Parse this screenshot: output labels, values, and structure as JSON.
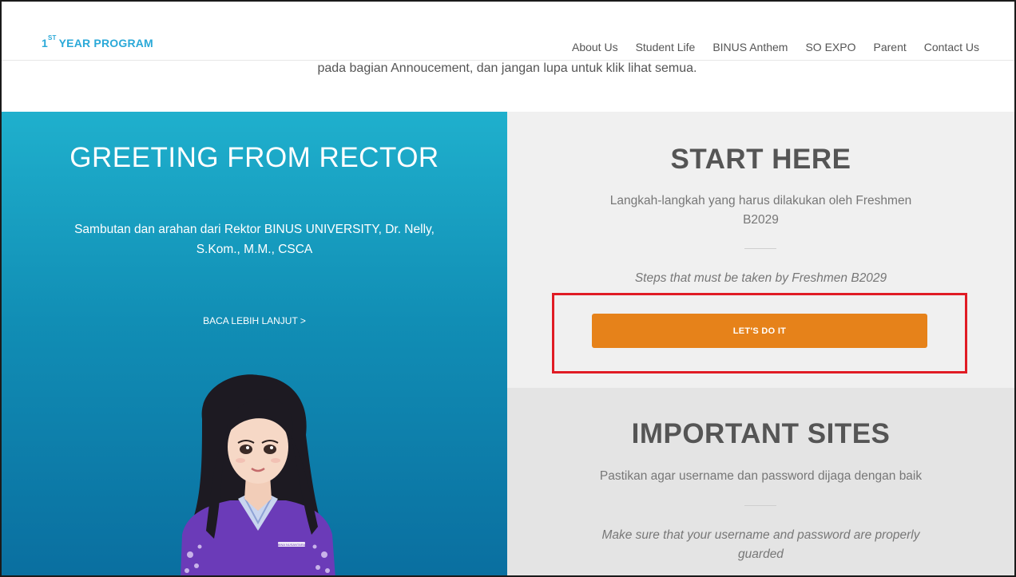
{
  "header": {
    "logo_sup": "ST",
    "logo_prefix": "1",
    "logo_text": "YEAR PROGRAM",
    "nav": [
      "About Us",
      "Student Life",
      "BINUS Anthem",
      "SO EXPO",
      "Parent",
      "Contact Us"
    ]
  },
  "announcement": "pada bagian Annoucement, dan jangan lupa untuk klik lihat semua.",
  "greeting": {
    "title": "GREETING FROM RECTOR",
    "subtitle": "Sambutan dan arahan dari Rektor BINUS UNIVERSITY, Dr. Nelly, S.Kom., M.M., CSCA",
    "link": "BACA LEBIH LANJUT >",
    "badge_text": "BINA NUSANTARA"
  },
  "start_here": {
    "title": "START HERE",
    "text_id": "Langkah-langkah yang harus dilakukan oleh Freshmen B2029",
    "text_en": "Steps that must be taken by Freshmen B2029",
    "button": "LET'S DO IT"
  },
  "important_sites": {
    "title": "IMPORTANT SITES",
    "text_id": "Pastikan agar username dan password dijaga dengan baik",
    "text_en": "Make sure that your username and password are properly guarded"
  },
  "colors": {
    "brand_blue": "#2aa9d8",
    "cta_orange": "#e6821a",
    "highlight_red": "#e01b24"
  }
}
